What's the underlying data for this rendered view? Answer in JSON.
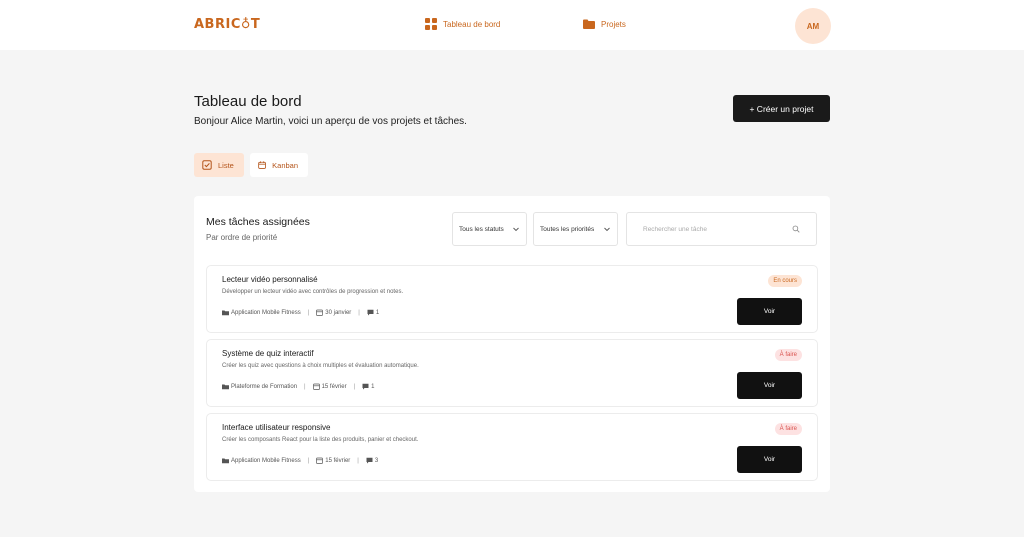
{
  "app": {
    "logo_text": "ABRIC♁T"
  },
  "nav": {
    "items": [
      {
        "label": "Tableau de bord",
        "icon": "grid-icon"
      },
      {
        "label": "Projets",
        "icon": "folder-icon"
      }
    ],
    "avatar_initials": "AM"
  },
  "header": {
    "title": "Tableau de bord",
    "subtitle": "Bonjour Alice Martin, voici un aperçu de vos projets et tâches.",
    "create_button": "+ Créer un projet"
  },
  "view_toggle": {
    "list_label": "Liste",
    "kanban_label": "Kanban"
  },
  "tasks_card": {
    "title": "Mes tâches assignées",
    "subtitle": "Par ordre de priorité",
    "filters": {
      "status_label": "Tous les statuts",
      "priority_label": "Toutes les priorités"
    },
    "search_placeholder": "Rechercher une tâche",
    "tasks": [
      {
        "title": "Lecteur vidéo personnalisé",
        "description": "Développer un lecteur vidéo avec contrôles de progression et notes.",
        "project": "Application Mobile Fitness",
        "date": "30 janvier",
        "comments": "1",
        "status": "En cours",
        "action": "Voir"
      },
      {
        "title": "Système de quiz interactif",
        "description": "Créer les quiz avec questions à choix multiples et évaluation automatique.",
        "project": "Plateforme de Formation",
        "date": "15 février",
        "comments": "1",
        "status": "À faire",
        "action": "Voir"
      },
      {
        "title": "Interface utilisateur responsive",
        "description": "Créer les composants React pour la liste des produits, panier et checkout.",
        "project": "Application Mobile Fitness",
        "date": "15 février",
        "comments": "3",
        "status": "À faire",
        "action": "Voir"
      }
    ]
  },
  "colors": {
    "accent": "#c9671e",
    "accent_light": "#fde4d4",
    "todo_badge_bg": "#fde2e2",
    "todo_badge_text": "#d9534f",
    "dark_button": "#1a1a1a"
  }
}
